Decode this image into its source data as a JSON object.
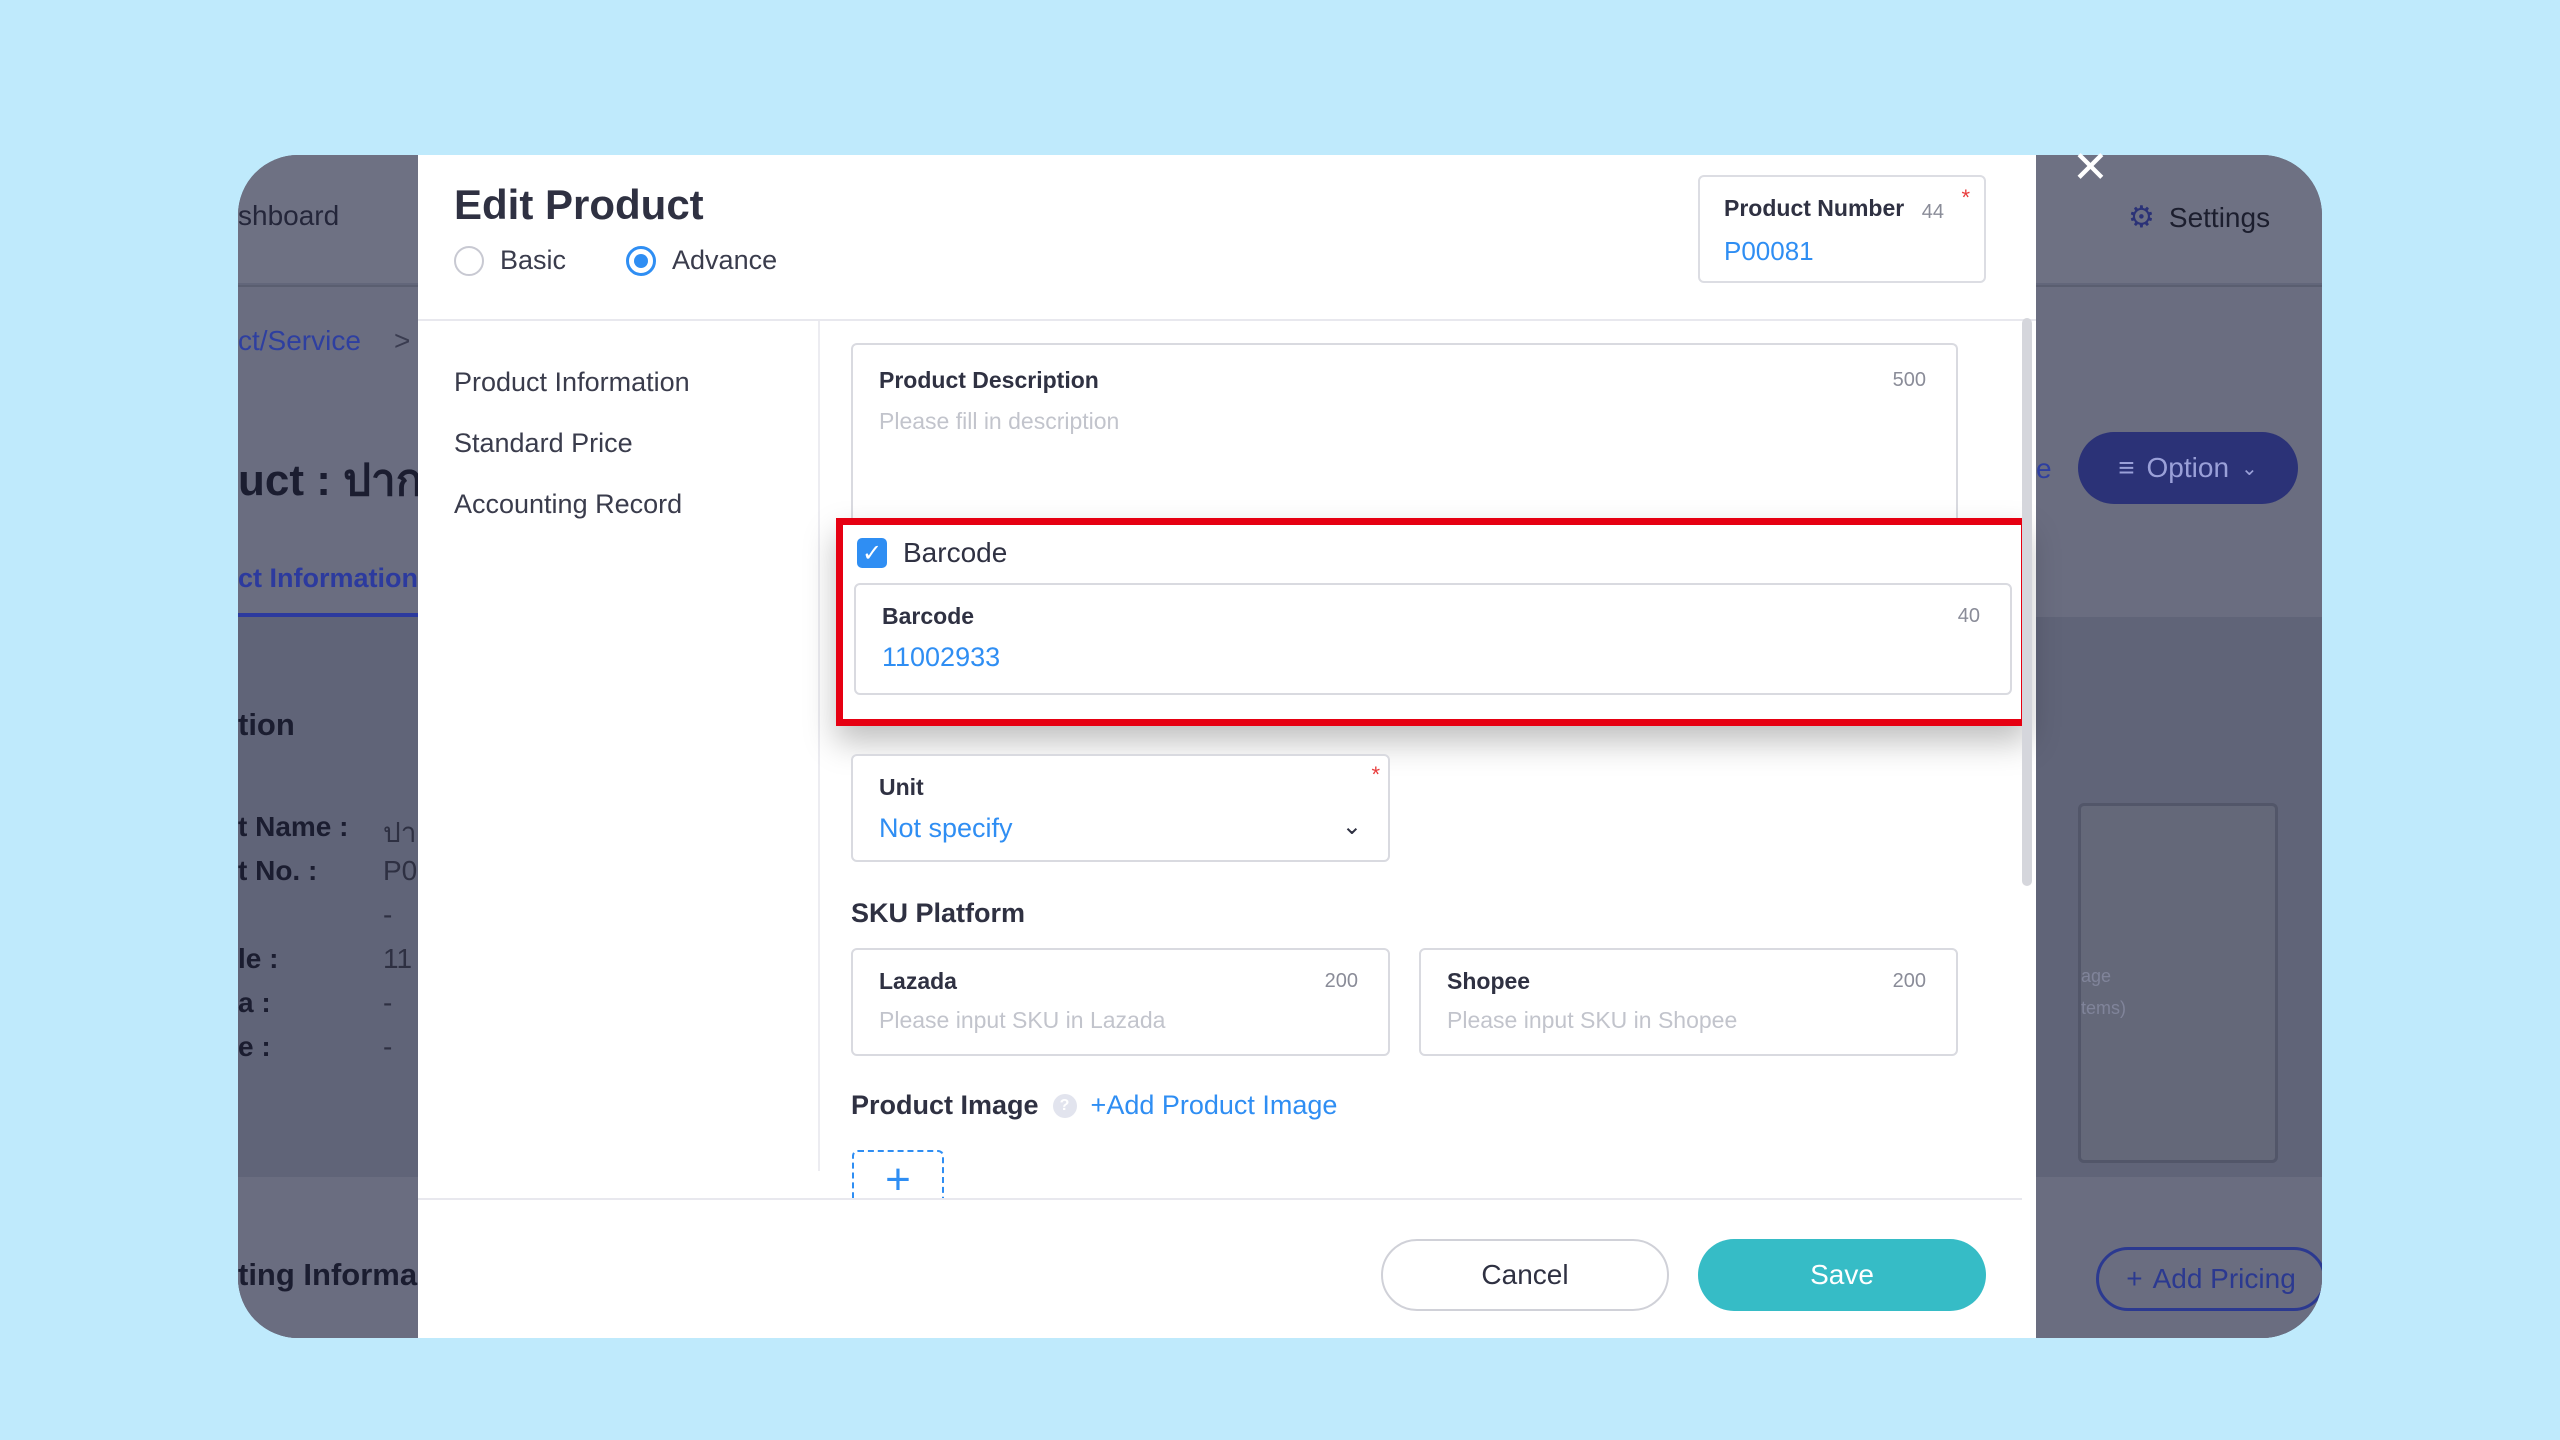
{
  "background": {
    "nav_dashboard": "shboard",
    "settings_label": "Settings",
    "breadcrumb_link": "ct/Service",
    "breadcrumb_sep": ">",
    "page_title": "uct : ปากก",
    "tab_label": "ct Information",
    "section_label": "tion",
    "option_label": "Option",
    "option_link": "e",
    "detail_rows": [
      {
        "label": "t Name :",
        "value": "ปา"
      },
      {
        "label": "t No. :",
        "value": "P0"
      },
      {
        "label": "",
        "value": "-"
      },
      {
        "label": "le :",
        "value": "11"
      },
      {
        "label": "a :",
        "value": "-"
      },
      {
        "label": "e :",
        "value": "-"
      }
    ],
    "box_text_1": "age",
    "box_text_2": "tems)",
    "bottom_section": "ting Informa",
    "add_pricing": "Add Pricing"
  },
  "modal": {
    "title": "Edit Product",
    "modes": [
      {
        "label": "Basic",
        "selected": false
      },
      {
        "label": "Advance",
        "selected": true
      }
    ],
    "product_number": {
      "label": "Product Number",
      "count": "44",
      "value": "P00081"
    },
    "nav_items": [
      "Product Information",
      "Standard Price",
      "Accounting Record"
    ],
    "description": {
      "label": "Product Description",
      "count": "500",
      "placeholder": "Please fill in description"
    },
    "barcode_toggle": "Barcode",
    "barcode": {
      "label": "Barcode",
      "count": "40",
      "value": "11002933"
    },
    "unit": {
      "label": "Unit",
      "value": "Not specify"
    },
    "sku_title": "SKU Platform",
    "lazada": {
      "label": "Lazada",
      "count": "200",
      "placeholder": "Please input SKU in Lazada"
    },
    "shopee": {
      "label": "Shopee",
      "count": "200",
      "placeholder": "Please input SKU in Shopee"
    },
    "image_title": "Product Image",
    "add_image": "+Add Product Image",
    "cancel": "Cancel",
    "save": "Save"
  },
  "colors": {
    "accent": "#2f8ef3",
    "save": "#36bcc6",
    "highlight": "#e60012",
    "page_bg": "#bfeafc"
  }
}
